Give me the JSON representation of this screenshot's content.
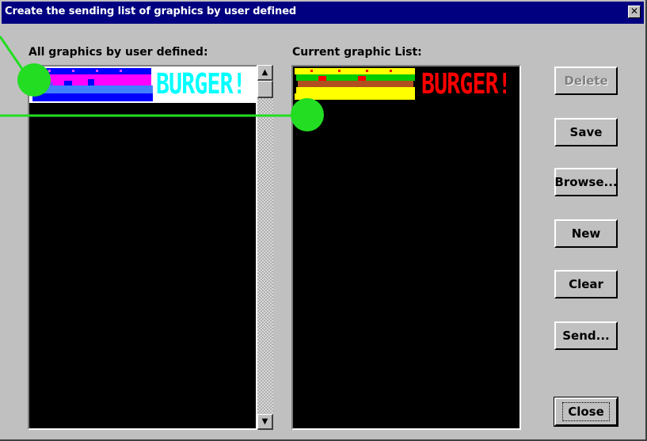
{
  "window": {
    "title": "Create the sending list of graphics by user defined",
    "close_glyph": "✕"
  },
  "left_panel": {
    "label": "All graphics by user defined:",
    "items": [
      {
        "name": "burger-user-graphic",
        "text": "BURGER!",
        "text_color": "#00ffff",
        "bg": "#ffffff"
      }
    ]
  },
  "right_panel": {
    "label": "Current graphic List:",
    "items": [
      {
        "name": "burger-current-graphic",
        "text": "BURGER!",
        "text_color": "#ff0000",
        "bg": "#000000"
      }
    ]
  },
  "scrollbar": {
    "up_glyph": "▲",
    "down_glyph": "▼"
  },
  "buttons": {
    "delete": "Delete",
    "save": "Save",
    "browse": "Browse...",
    "new": "New",
    "clear": "Clear",
    "send": "Send...",
    "close": "Close"
  },
  "colors": {
    "title_bar": "#000080",
    "dialog_face": "#c0c0c0",
    "callout": "#22dd22"
  }
}
